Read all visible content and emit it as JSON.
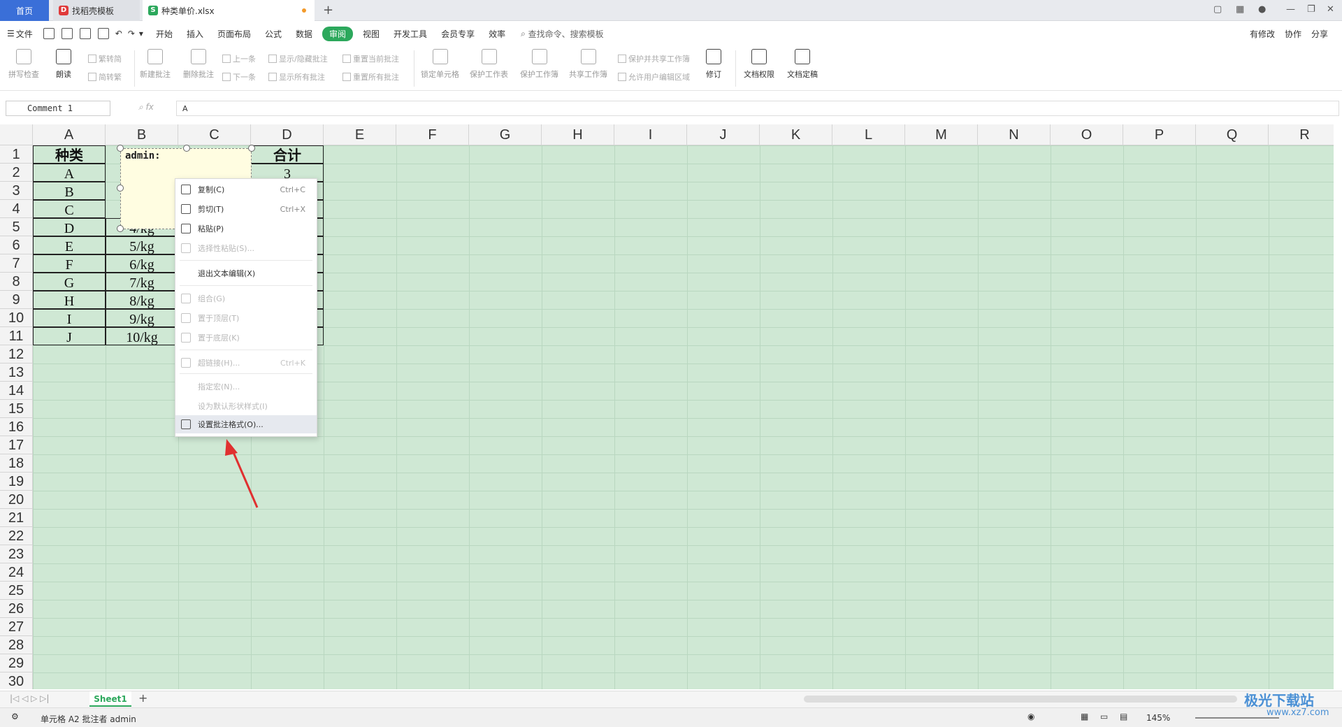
{
  "tabs": {
    "home": "首页",
    "t1": "找稻壳模板",
    "t2": "种类单价.xlsx"
  },
  "menu": {
    "file": "文件",
    "items": [
      "开始",
      "插入",
      "页面布局",
      "公式",
      "数据",
      "审阅",
      "视图",
      "开发工具",
      "会员专享",
      "效率"
    ],
    "active": "审阅",
    "search": "查找命令、搜索模板",
    "right": [
      "有修改",
      "协作",
      "分享"
    ]
  },
  "ribbon": {
    "spell": "拼写检查",
    "read": "朗读",
    "t2s": "繁转简",
    "s2t": "简转繁",
    "newc": "新建批注",
    "delc": "删除批注",
    "prev": "上一条",
    "next": "下一条",
    "showhide": "显示/隐藏批注",
    "showall": "显示所有批注",
    "resetcur": "重置当前批注",
    "resetall": "重置所有批注",
    "lock": "锁定单元格",
    "protsheet": "保护工作表",
    "protbook": "保护工作簿",
    "share": "共享工作簿",
    "protshare": "保护并共享工作簿",
    "allowedit": "允许用户编辑区域",
    "track": "修订",
    "perm": "文档权限",
    "final": "文档定稿"
  },
  "formula": {
    "name": "Comment 1",
    "value": "A"
  },
  "columns": [
    "A",
    "B",
    "C",
    "D",
    "E",
    "F",
    "G",
    "H",
    "I",
    "J",
    "K",
    "L",
    "M",
    "N",
    "O",
    "P",
    "Q",
    "R"
  ],
  "rows": [
    "1",
    "2",
    "3",
    "4",
    "5",
    "6",
    "7",
    "8",
    "9",
    "10",
    "11",
    "12",
    "13",
    "14",
    "15",
    "16",
    "17",
    "18",
    "19",
    "20",
    "21",
    "22",
    "23",
    "24",
    "25",
    "26",
    "27",
    "28",
    "29",
    "30"
  ],
  "table": {
    "headerA": "种类",
    "headerD": "合计",
    "colA": [
      "A",
      "B",
      "C",
      "D",
      "E",
      "F",
      "G",
      "H",
      "I",
      "J"
    ],
    "colB": [
      "4/kg",
      "5/kg",
      "6/kg",
      "7/kg",
      "8/kg",
      "9/kg",
      "10/kg"
    ],
    "d2": "3"
  },
  "comment": {
    "author": "admin:"
  },
  "context_menu": [
    {
      "label": "复制(C)",
      "shortcut": "Ctrl+C",
      "enabled": true
    },
    {
      "label": "剪切(T)",
      "shortcut": "Ctrl+X",
      "enabled": true
    },
    {
      "label": "粘贴(P)",
      "shortcut": "",
      "enabled": true
    },
    {
      "label": "选择性粘贴(S)...",
      "shortcut": "",
      "enabled": false
    },
    {
      "label": "退出文本编辑(X)",
      "shortcut": "",
      "enabled": true
    },
    {
      "label": "组合(G)",
      "shortcut": "",
      "enabled": false
    },
    {
      "label": "置于顶层(T)",
      "shortcut": "",
      "enabled": false
    },
    {
      "label": "置于底层(K)",
      "shortcut": "",
      "enabled": false
    },
    {
      "label": "超链接(H)...",
      "shortcut": "Ctrl+K",
      "enabled": false
    },
    {
      "label": "指定宏(N)...",
      "shortcut": "",
      "enabled": false
    },
    {
      "label": "设为默认形状样式(I)",
      "shortcut": "",
      "enabled": false
    },
    {
      "label": "设置批注格式(O)...",
      "shortcut": "",
      "enabled": true
    }
  ],
  "sheet": "Sheet1",
  "status": {
    "text": "单元格 A2 批注者 admin",
    "zoom": "145%"
  },
  "watermark": {
    "line1": "极光下载站",
    "line2": "www.xz7.com"
  },
  "colors": {
    "accent": "#2ca85c",
    "grid_bg": "#cfe8d4",
    "annotation_arrow": "#e03030"
  }
}
